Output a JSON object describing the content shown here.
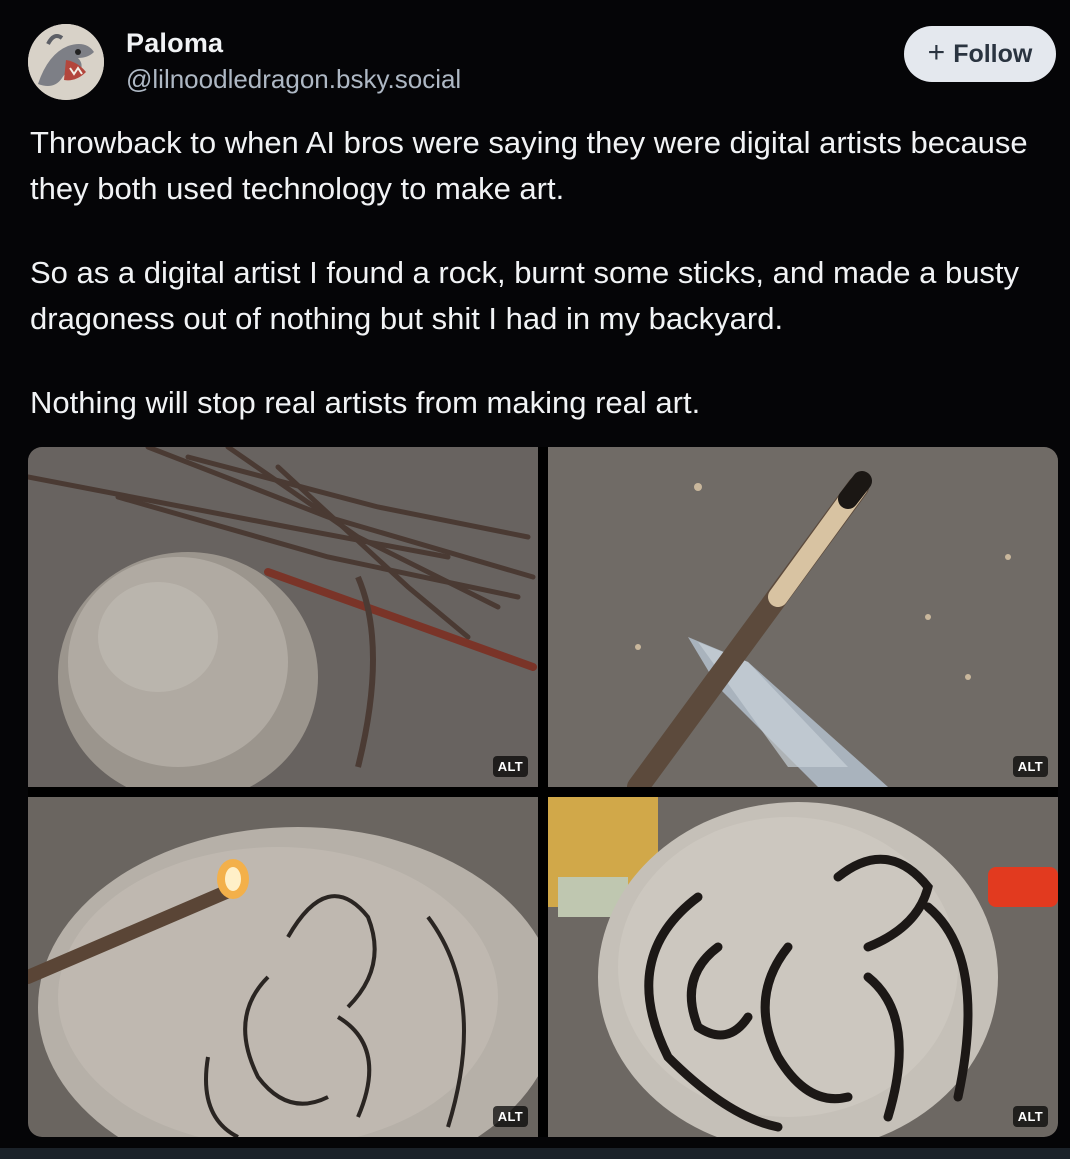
{
  "author": {
    "name": "Paloma",
    "handle": "@lilnoodledragon.bsky.social",
    "avatar_icon": "dragon-avatar-icon"
  },
  "follow_button": {
    "icon": "plus-icon",
    "plus_glyph": "+",
    "label": "Follow"
  },
  "post": {
    "paragraphs": [
      "Throwback to when AI bros were saying they were digital artists because they both used technology to make art.",
      "So as a digital artist I found a rock, burnt some sticks, and made a busty dragoness out of nothing but shit I had in my backyard.",
      "Nothing will stop real artists from making real art."
    ]
  },
  "images": [
    {
      "alt_badge": "ALT"
    },
    {
      "alt_badge": "ALT"
    },
    {
      "alt_badge": "ALT"
    },
    {
      "alt_badge": "ALT"
    }
  ],
  "colors": {
    "background": "#050507",
    "text": "#f1f3f5",
    "handle": "#aeb8c4",
    "follow_bg": "#e4e8ee"
  }
}
